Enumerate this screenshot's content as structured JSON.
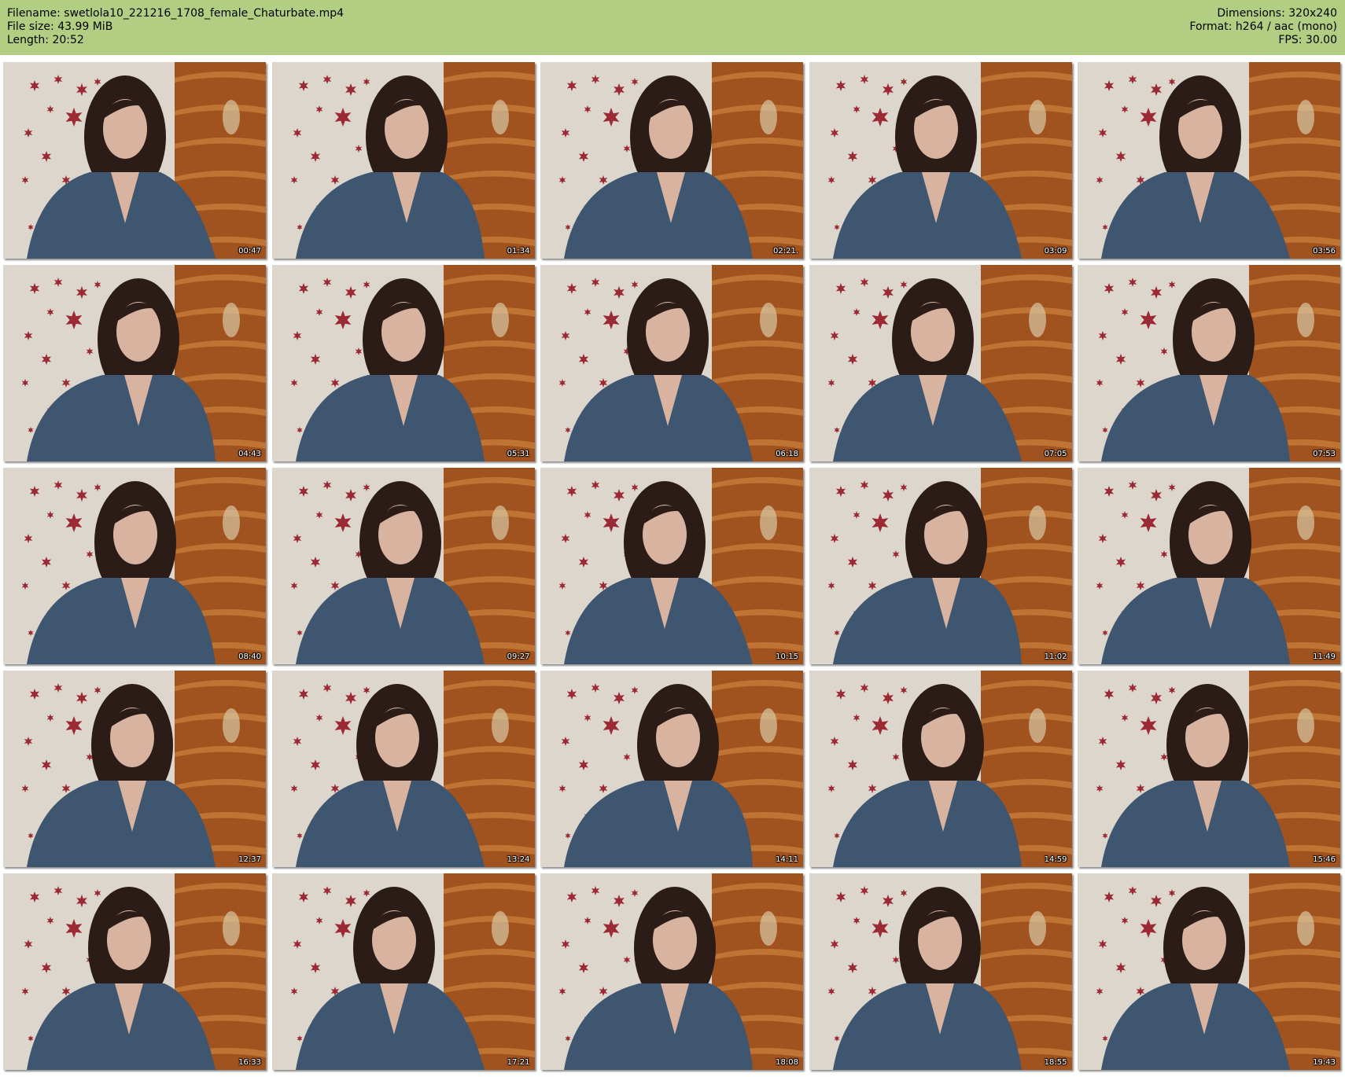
{
  "header": {
    "filename": "Filename: swetlola10_221216_1708_female_Chaturbate.mp4",
    "filesize": "File size: 43.99 MiB",
    "length": "Length: 20:52",
    "dimensions": "Dimensions: 320x240",
    "format": "Format: h264 / aac (mono)",
    "fps": "FPS: 30.00",
    "bg_color": "#b1ce83"
  },
  "thumbnails": [
    {
      "time": "00:47"
    },
    {
      "time": "01:34"
    },
    {
      "time": "02:21."
    },
    {
      "time": "03:09"
    },
    {
      "time": "03:56"
    },
    {
      "time": "04:43"
    },
    {
      "time": "05:31"
    },
    {
      "time": "06:18"
    },
    {
      "time": "07:05"
    },
    {
      "time": "07:53"
    },
    {
      "time": "08:40"
    },
    {
      "time": "09:27"
    },
    {
      "time": "10:15"
    },
    {
      "time": "11:02"
    },
    {
      "time": "11:49"
    },
    {
      "time": "12:37"
    },
    {
      "time": "13:24"
    },
    {
      "time": "14:11"
    },
    {
      "time": "14:59"
    },
    {
      "time": "15:46"
    },
    {
      "time": "16:33"
    },
    {
      "time": "17:21"
    },
    {
      "time": "18:08"
    },
    {
      "time": "18:55"
    },
    {
      "time": "19:43"
    }
  ],
  "colors": {
    "wall": "#dcd6cc",
    "shelf": "#a0521f",
    "shirt": "#3e5670",
    "hair": "#2b1c17",
    "skin": "#d8b4a0",
    "star": "#9c2a35"
  }
}
